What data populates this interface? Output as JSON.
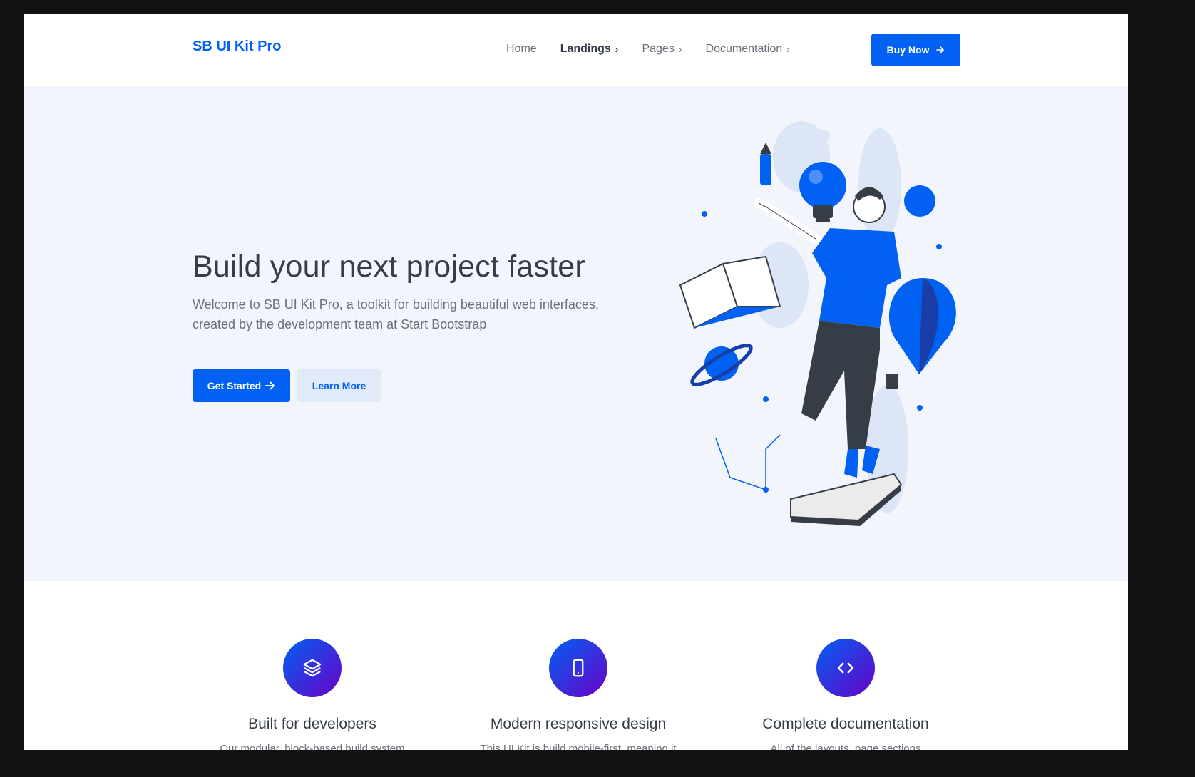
{
  "navbar": {
    "brand": "SB UI Kit Pro",
    "links": [
      {
        "label": "Home",
        "has_chevron": false
      },
      {
        "label": "Landings",
        "has_chevron": true
      },
      {
        "label": "Pages",
        "has_chevron": true
      },
      {
        "label": "Documentation",
        "has_chevron": true
      }
    ],
    "buy_label": "Buy Now"
  },
  "hero": {
    "title": "Build your next project faster",
    "lead": "Welcome to SB UI Kit Pro, a toolkit for building beautiful web interfaces, created by the development team at Start Bootstrap",
    "primary_button": "Get Started",
    "secondary_button": "Learn More"
  },
  "features": [
    {
      "icon": "layers-icon",
      "title": "Built for developers",
      "text": "Our modular, block-based build system"
    },
    {
      "icon": "smartphone-icon",
      "title": "Modern responsive design",
      "text": "This UI Kit is build mobile-first, meaning it"
    },
    {
      "icon": "code-icon",
      "title": "Complete documentation",
      "text": "All of the layouts, page sections"
    }
  ],
  "colors": {
    "primary": "#0061f2",
    "hero_bg": "#f2f6fc",
    "heading": "#363d47",
    "body_text": "#69707a",
    "gradient_end": "#6900c7"
  }
}
